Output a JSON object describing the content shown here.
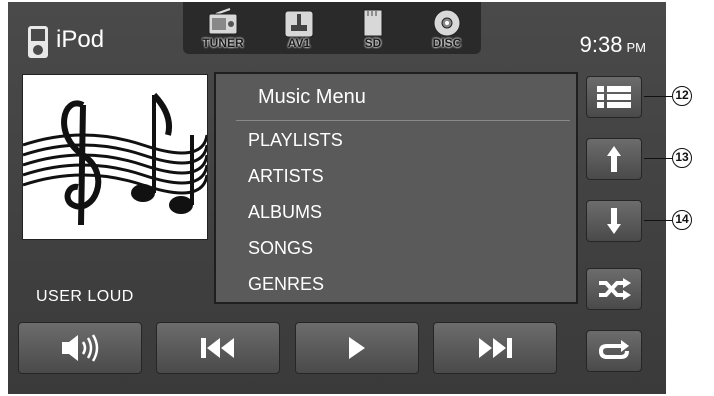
{
  "header": {
    "source_label": "iPod",
    "source_tabs": [
      {
        "label": "TUNER",
        "icon": "radio-icon"
      },
      {
        "label": "AV1",
        "icon": "joystick-icon"
      },
      {
        "label": "SD",
        "icon": "sd-card-icon"
      },
      {
        "label": "DISC",
        "icon": "disc-icon"
      }
    ],
    "clock": {
      "time": "9:38",
      "ampm": "PM"
    }
  },
  "list": {
    "title": "Music Menu",
    "items": [
      "PLAYLISTS",
      "ARTISTS",
      "ALBUMS",
      "SONGS",
      "GENRES"
    ]
  },
  "sound_mode": "USER  LOUD",
  "side_buttons": [
    {
      "icon": "list-menu-icon",
      "callout": "12"
    },
    {
      "icon": "arrow-up-icon",
      "callout": "13"
    },
    {
      "icon": "arrow-down-icon",
      "callout": "14"
    },
    {
      "icon": "shuffle-icon"
    },
    {
      "icon": "repeat-icon"
    }
  ],
  "transport": [
    "volume-icon",
    "previous-track-icon",
    "play-icon",
    "next-track-icon"
  ],
  "colors": {
    "screen_bg": "#444444",
    "panel_bg": "#5a5a5a",
    "text": "#ffffff"
  }
}
